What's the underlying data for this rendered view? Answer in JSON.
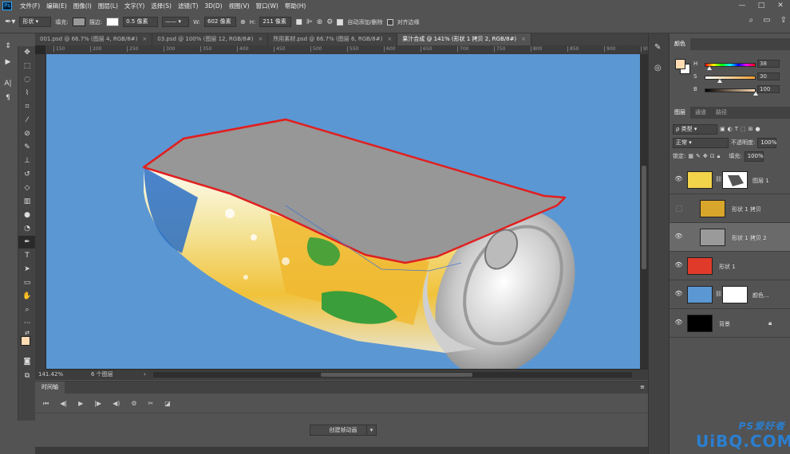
{
  "app": {
    "logo": "Ps"
  },
  "menu": [
    "文件(F)",
    "编辑(E)",
    "图像(I)",
    "图层(L)",
    "文字(Y)",
    "选择(S)",
    "滤镜(T)",
    "3D(D)",
    "视图(V)",
    "窗口(W)",
    "帮助(H)"
  ],
  "window_controls": [
    "—",
    "□",
    "✕"
  ],
  "options": {
    "mode": "形状",
    "fill_label": "填充:",
    "stroke_label": "描边:",
    "stroke_width": "0.5 像素",
    "w_label": "W:",
    "w_value": "602 像素",
    "h_label": "H:",
    "h_value": "211 像素",
    "auto_add_delete": "自动添加/删除",
    "align_edges": "对齐边缘",
    "fill_color": "#999999",
    "stroke_color": "#ffffff"
  },
  "tabs": [
    {
      "label": "001.psd @ 66.7% (图层 4, RGB/8#)",
      "active": false
    },
    {
      "label": "03.psd @ 100% (图层 12, RGB/8#)",
      "active": false
    },
    {
      "label": "所用素材.psd @ 66.7% (图层 6, RGB/8#)",
      "active": false
    },
    {
      "label": "果汁合成 @ 141% (形状 1 拷贝 2, RGB/8#)",
      "active": true
    }
  ],
  "tab_close": "×",
  "ruler_ticks": [
    "150",
    "200",
    "250",
    "300",
    "350",
    "400",
    "450",
    "500",
    "550",
    "600",
    "650",
    "700",
    "750",
    "800",
    "850",
    "900",
    "950"
  ],
  "status": {
    "zoom": "141.42%",
    "layers": "6 个图层"
  },
  "timeline": {
    "tab": "时间轴",
    "create_button": "创建帧动画",
    "dropdown": "▾"
  },
  "timeline_controls": [
    "⏮",
    "◀|",
    "▶",
    "|▶",
    "◀)",
    "⚙",
    "✂",
    "◪"
  ],
  "color_panel": {
    "tab": "颜色",
    "h_label": "H",
    "h_value": "38",
    "h_pos": 0.1,
    "s_label": "S",
    "s_value": "30",
    "s_pos": 0.3,
    "b_label": "B",
    "b_value": "100",
    "b_pos": 1.0,
    "fg_color": "#ffdcb4",
    "bg_color": "#ffffff"
  },
  "layers_panel": {
    "tabs": [
      "图层",
      "通道",
      "路径"
    ],
    "filter_label": "ρ 类型",
    "blend_mode": "正常",
    "opacity_label": "不透明度:",
    "opacity_value": "100%",
    "lock_label": "锁定:",
    "fill_label": "填充:",
    "fill_value": "100%",
    "layers": [
      {
        "name": "图层 1",
        "visible": true,
        "selected": false,
        "thumb": "#f2d44a"
      },
      {
        "name": "形状 1 拷贝",
        "visible": false,
        "selected": false,
        "thumb": "#d9a62c"
      },
      {
        "name": "形状 1 拷贝 2",
        "visible": true,
        "selected": true,
        "thumb": "#9a9a9a"
      },
      {
        "name": "形状 1",
        "visible": true,
        "selected": false,
        "thumb": "#e03a2a"
      },
      {
        "name": "颜色...",
        "visible": true,
        "selected": false,
        "thumb": "#5b97d3"
      },
      {
        "name": "背景",
        "visible": true,
        "selected": false,
        "thumb": "#000000"
      }
    ]
  },
  "watermark": {
    "top": "PS爱好者",
    "bottom": "UiBQ.COM"
  }
}
